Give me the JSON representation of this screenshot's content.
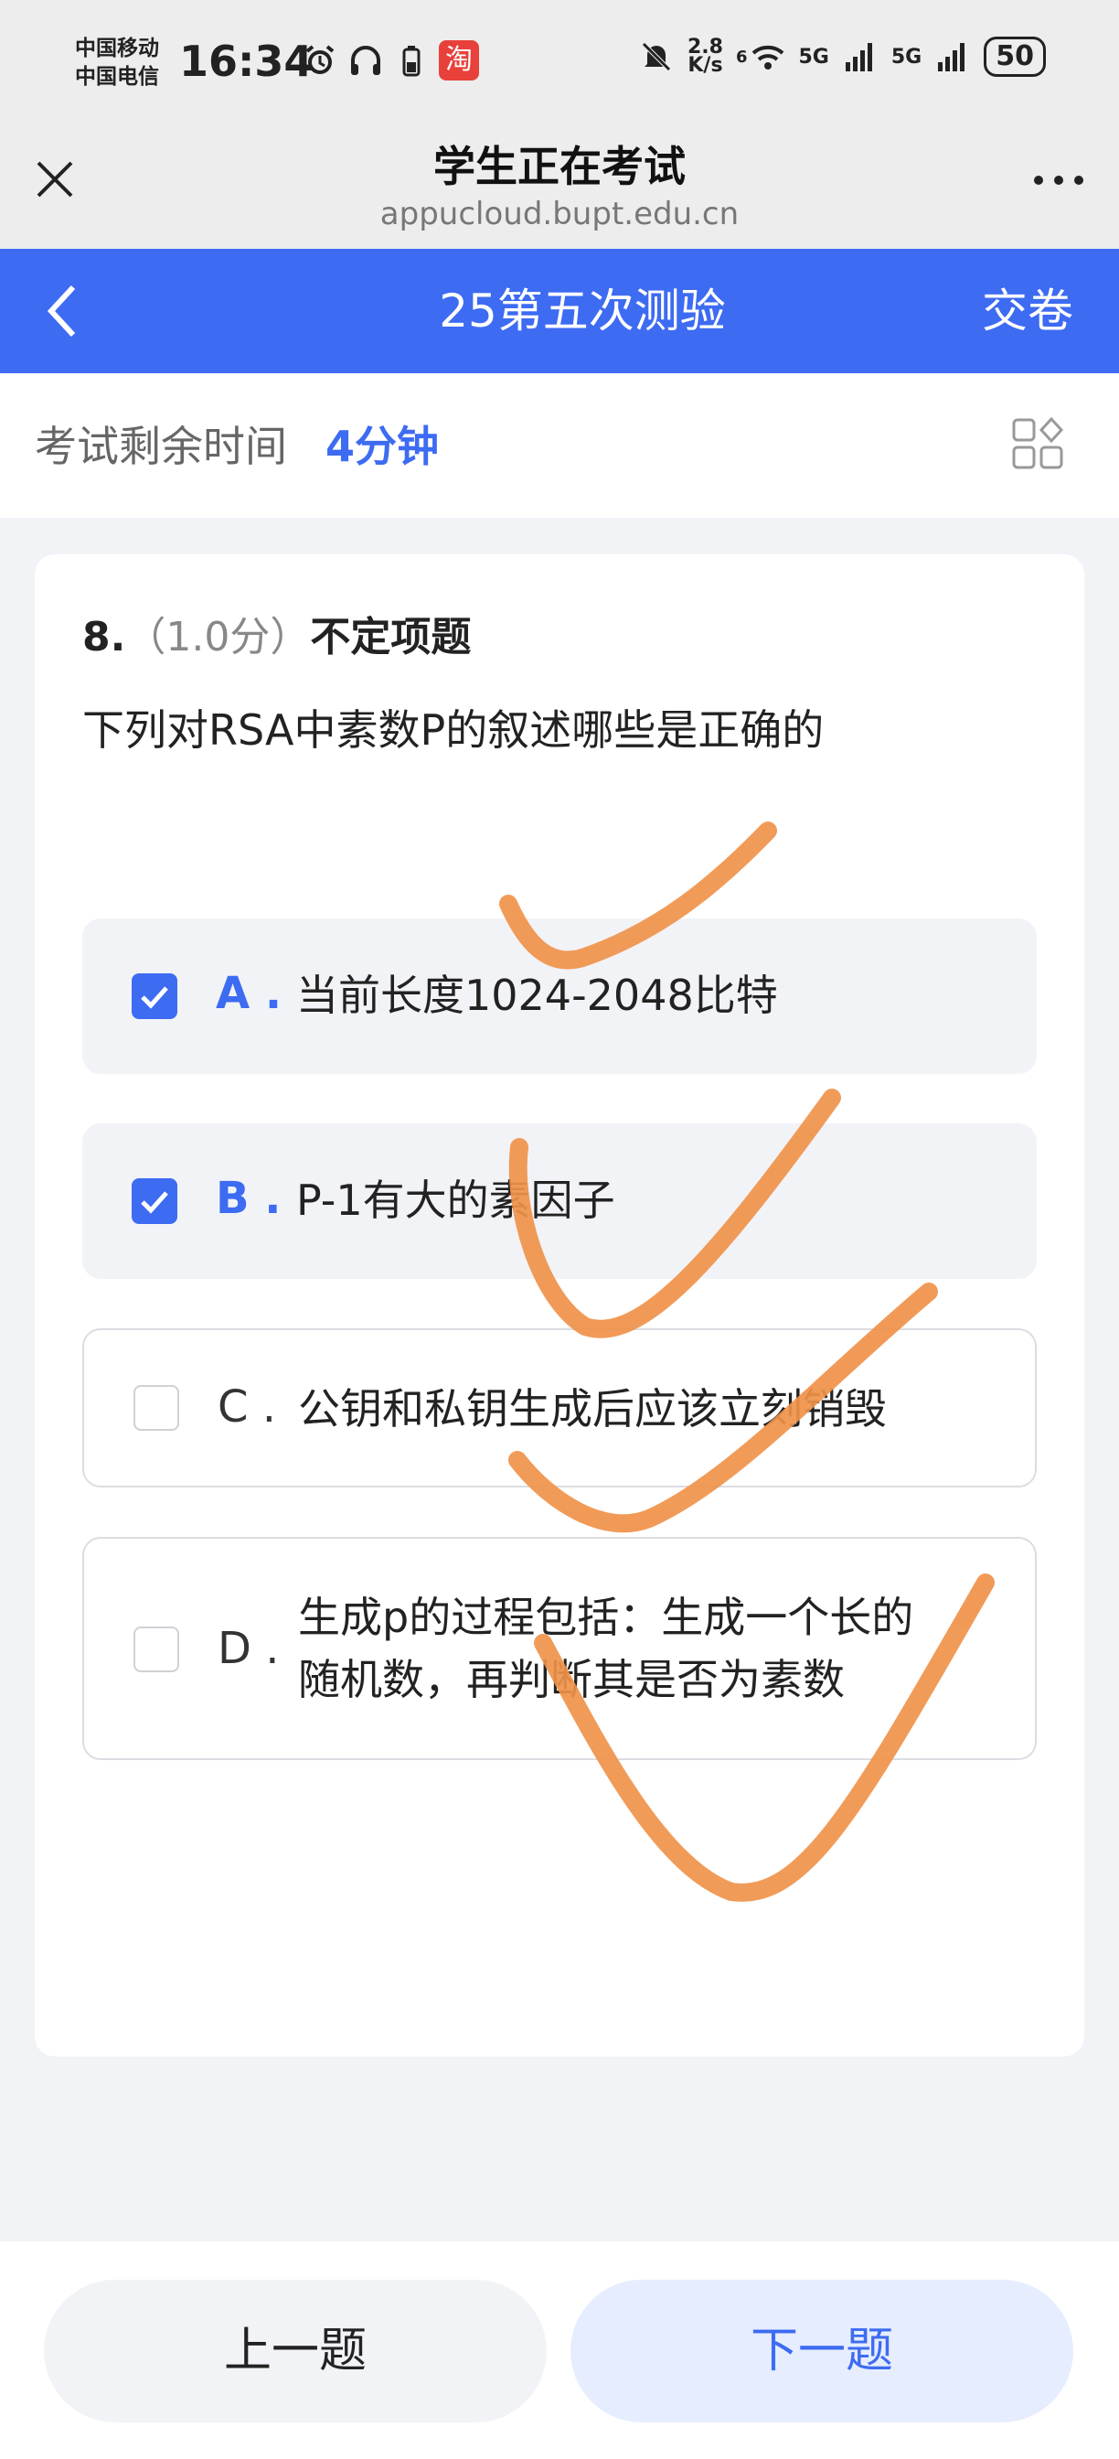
{
  "status_bar": {
    "carrier_1": "中国移动",
    "carrier_2": "中国电信",
    "time": "16:34",
    "net_speed_value": "2.8",
    "net_speed_unit": "K/s",
    "signal_label_1": "5G",
    "signal_label_2": "5G",
    "wifi_label": "6",
    "battery": "50",
    "app_badge": "淘"
  },
  "browser": {
    "title": "学生正在考试",
    "url": "appucloud.bupt.edu.cn"
  },
  "appbar": {
    "title": "25第五次测验",
    "submit_label": "交卷"
  },
  "timer": {
    "label": "考试剩余时间",
    "value": "4分钟"
  },
  "question": {
    "number": "8.",
    "score": "（1.0分）",
    "type": "不定项题",
    "text": "下列对RSA中素数P的叙述哪些是正确的",
    "options": [
      {
        "letter": "A .",
        "text": "当前长度1024-2048比特",
        "selected": true
      },
      {
        "letter": "B .",
        "text": "P-1有大的素因子",
        "selected": true
      },
      {
        "letter": "C .",
        "text": "公钥和私钥生成后应该立刻销毁",
        "selected": false
      },
      {
        "letter": "D .",
        "text_line1": "生成p的过程包括：生成一个长的",
        "text_line2": "随机数，再判断其是否为素数",
        "selected": false
      }
    ]
  },
  "footer": {
    "prev_label": "上一题",
    "next_label": "下一题"
  },
  "colors": {
    "accent": "#3d6bf2",
    "annotation": "#f0924a",
    "background": "#f2f3f7"
  }
}
